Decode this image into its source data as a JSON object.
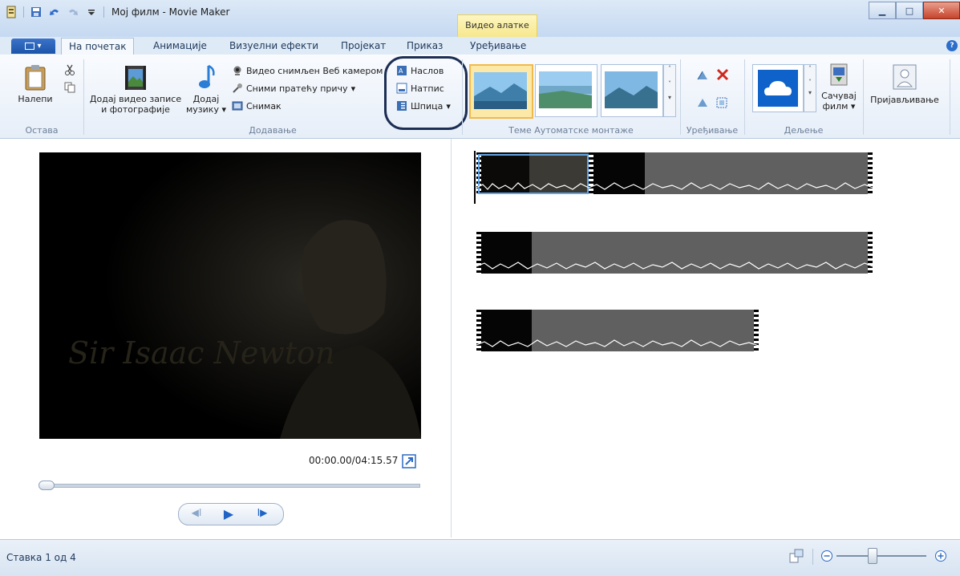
{
  "window": {
    "title": "Мој филм - Movie Maker",
    "context_group": "Видео алатке"
  },
  "tabs": [
    {
      "label": "На почетак",
      "active": true
    },
    {
      "label": "Анимације"
    },
    {
      "label": "Визуелни ефекти"
    },
    {
      "label": "Пројекат"
    },
    {
      "label": "Приказ"
    },
    {
      "label": "Уређивање"
    }
  ],
  "ribbon": {
    "clipboard": {
      "paste": "Налепи",
      "group": "Остава"
    },
    "add": {
      "add_video_line1": "Додај видео записе",
      "add_video_line2": "и фотографије",
      "add_music_line1": "Додај",
      "add_music_line2": "музику",
      "webcam": "Видео снимљен Веб камером",
      "narration": "Сними пратећу причу",
      "snapshot": "Снимак",
      "title": "Наслов",
      "caption": "Натпис",
      "credits": "Шпица",
      "group": "Додавање"
    },
    "themes_group": "Теме Аутоматске монтаже",
    "editing_group": "Уређивање",
    "sharing": {
      "save_line1": "Сачувај",
      "save_line2": "филм",
      "group": "Дељење"
    },
    "signin": "Пријављивање"
  },
  "preview": {
    "overlay_text": "Sir Isaac Newton",
    "time": "00:00.00/04:15.57",
    "seek_position": 0
  },
  "status": {
    "item_text": "Ставка 1 од 4",
    "zoom_level": 0.15
  },
  "colors": {
    "accent": "#2b6ac4",
    "ribbon_bg": "#e6eef8",
    "context_tab": "#f6e78a"
  }
}
